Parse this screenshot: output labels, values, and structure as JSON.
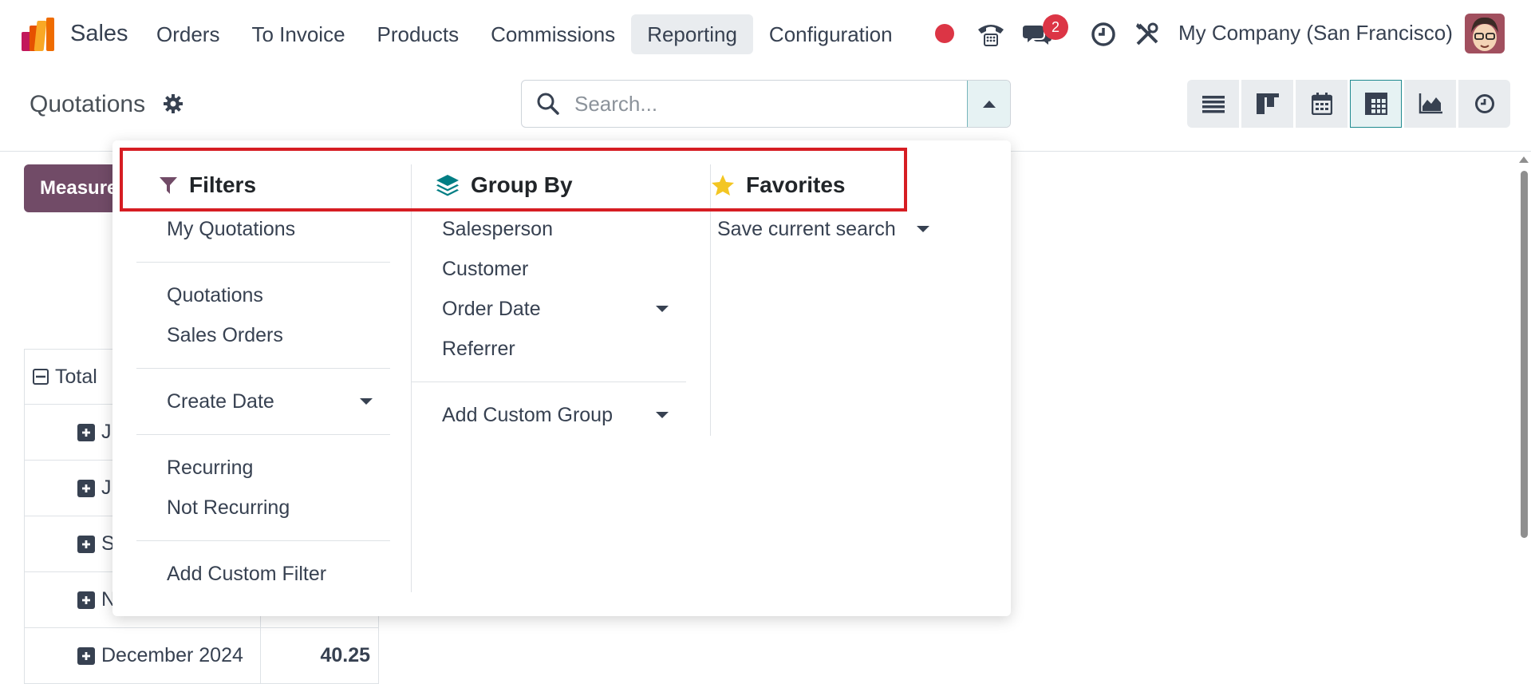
{
  "navbar": {
    "app_name": "Sales",
    "menu": [
      "Orders",
      "To Invoice",
      "Products",
      "Commissions",
      "Reporting",
      "Configuration"
    ],
    "active_menu": "Reporting",
    "notification_count": "2",
    "company": "My Company (San Francisco)",
    "icons": [
      "record-icon",
      "phone-icon",
      "chat-icon",
      "clock-icon",
      "tools-icon"
    ]
  },
  "control_panel": {
    "title": "Quotations",
    "search_placeholder": "Search...",
    "measures_label": "Measures",
    "views": [
      "list-icon",
      "kanban-icon",
      "calendar-icon",
      "pivot-icon",
      "graph-icon",
      "activity-icon"
    ],
    "active_view": "pivot-icon"
  },
  "pivot": {
    "total_label": "Total",
    "rows": [
      {
        "label": "Ju",
        "value": ""
      },
      {
        "label": "Ju",
        "value": ""
      },
      {
        "label": "S",
        "value": ""
      },
      {
        "label": "N",
        "value": ""
      },
      {
        "label": "December 2024",
        "value": "40.25"
      }
    ]
  },
  "dropdown": {
    "filters": {
      "title": "Filters",
      "groups": [
        [
          {
            "label": "My Quotations"
          }
        ],
        [
          {
            "label": "Quotations"
          },
          {
            "label": "Sales Orders"
          }
        ],
        [
          {
            "label": "Create Date",
            "caret": true
          }
        ],
        [
          {
            "label": "Recurring"
          },
          {
            "label": "Not Recurring"
          }
        ],
        [
          {
            "label": "Add Custom Filter"
          }
        ]
      ]
    },
    "group_by": {
      "title": "Group By",
      "items": [
        "Salesperson",
        "Customer",
        "Order Date",
        "Referrer"
      ],
      "custom": "Add Custom Group"
    },
    "favorites": {
      "title": "Favorites",
      "save": "Save current search"
    }
  },
  "colors": {
    "brand": "#714b67",
    "accent": "#1e8a8f",
    "danger": "#dc3545",
    "highlight": "#d61d23"
  }
}
